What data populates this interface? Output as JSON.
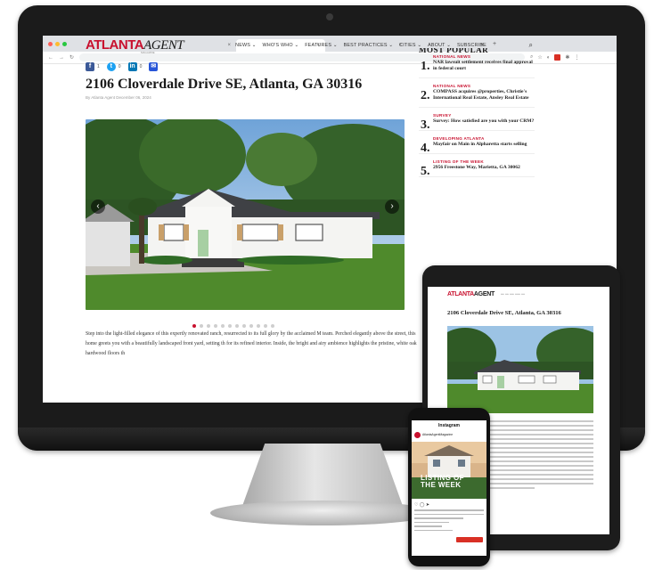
{
  "monitor": {
    "browser": {
      "tabs": [
        {
          "label": "×"
        },
        {
          "label": "×"
        },
        {
          "label": "×",
          "active": true
        },
        {
          "label": "×"
        },
        {
          "label": "×"
        }
      ],
      "new_tab": "+"
    },
    "site": {
      "logo_part1": "ATLANTA",
      "logo_part2": "AGENT",
      "logo_sub": "MAGAZINE",
      "nav": [
        "NEWS ⌄",
        "WHO'S WHO ⌄",
        "FEATURES ⌄",
        "BEST PRACTICES ⌄",
        "CITIES ⌄",
        "ABOUT ⌄",
        "SUBSCRIBE"
      ],
      "share_counts": {
        "facebook": "1",
        "twitter": "0",
        "linkedin": "0"
      },
      "headline": "2106 Cloverdale Drive SE, Atlanta, GA 30316",
      "byline": "By Atlanta Agent    December 06, 2024",
      "body": "Step into the light-filled elegance of this expertly renovated ranch, resurrected to its full glory by the acclaimed M team. Perched elegantly above the street, this home greets you with a beautifully landscaped front yard, setting th for its refined interior. Inside, the bright and airy ambience highlights the pristine, white oak hardwood floors th",
      "sidebar": {
        "title": "MOST POPULAR",
        "items": [
          {
            "num": "1.",
            "category": "NATIONAL NEWS",
            "title": "NAR lawsuit settlement receives final approval in federal court"
          },
          {
            "num": "2.",
            "category": "NATIONAL NEWS",
            "title": "COMPASS acquires @properties, Christie's International Real Estate, Ansley Real Estate"
          },
          {
            "num": "3.",
            "category": "SURVEY",
            "title": "Survey: How satisfied are you with your CRM?"
          },
          {
            "num": "4.",
            "category": "DEVELOPING ATLANTA",
            "title": "Mayfair on Main in Alpharetta starts selling"
          },
          {
            "num": "5.",
            "category": "LISTING OF THE WEEK",
            "title": "2956 Freestone Way, Marietta, GA 30062"
          }
        ]
      }
    }
  },
  "tablet": {
    "logo_part1": "ATLANTA",
    "logo_part2": "AGENT",
    "headline": "2106 Cloverdale Drive SE, Atlanta, GA 30316"
  },
  "phone": {
    "app_title": "Instagram",
    "username": "AtlantaAgentMagazine",
    "overlay_line1": "LISTING OF",
    "overlay_line2": "THE WEEK"
  },
  "colors": {
    "brand_red": "#c8102e",
    "facebook": "#3b5998",
    "twitter": "#1da1f2",
    "linkedin": "#0077b5",
    "email": "#2755d8"
  }
}
